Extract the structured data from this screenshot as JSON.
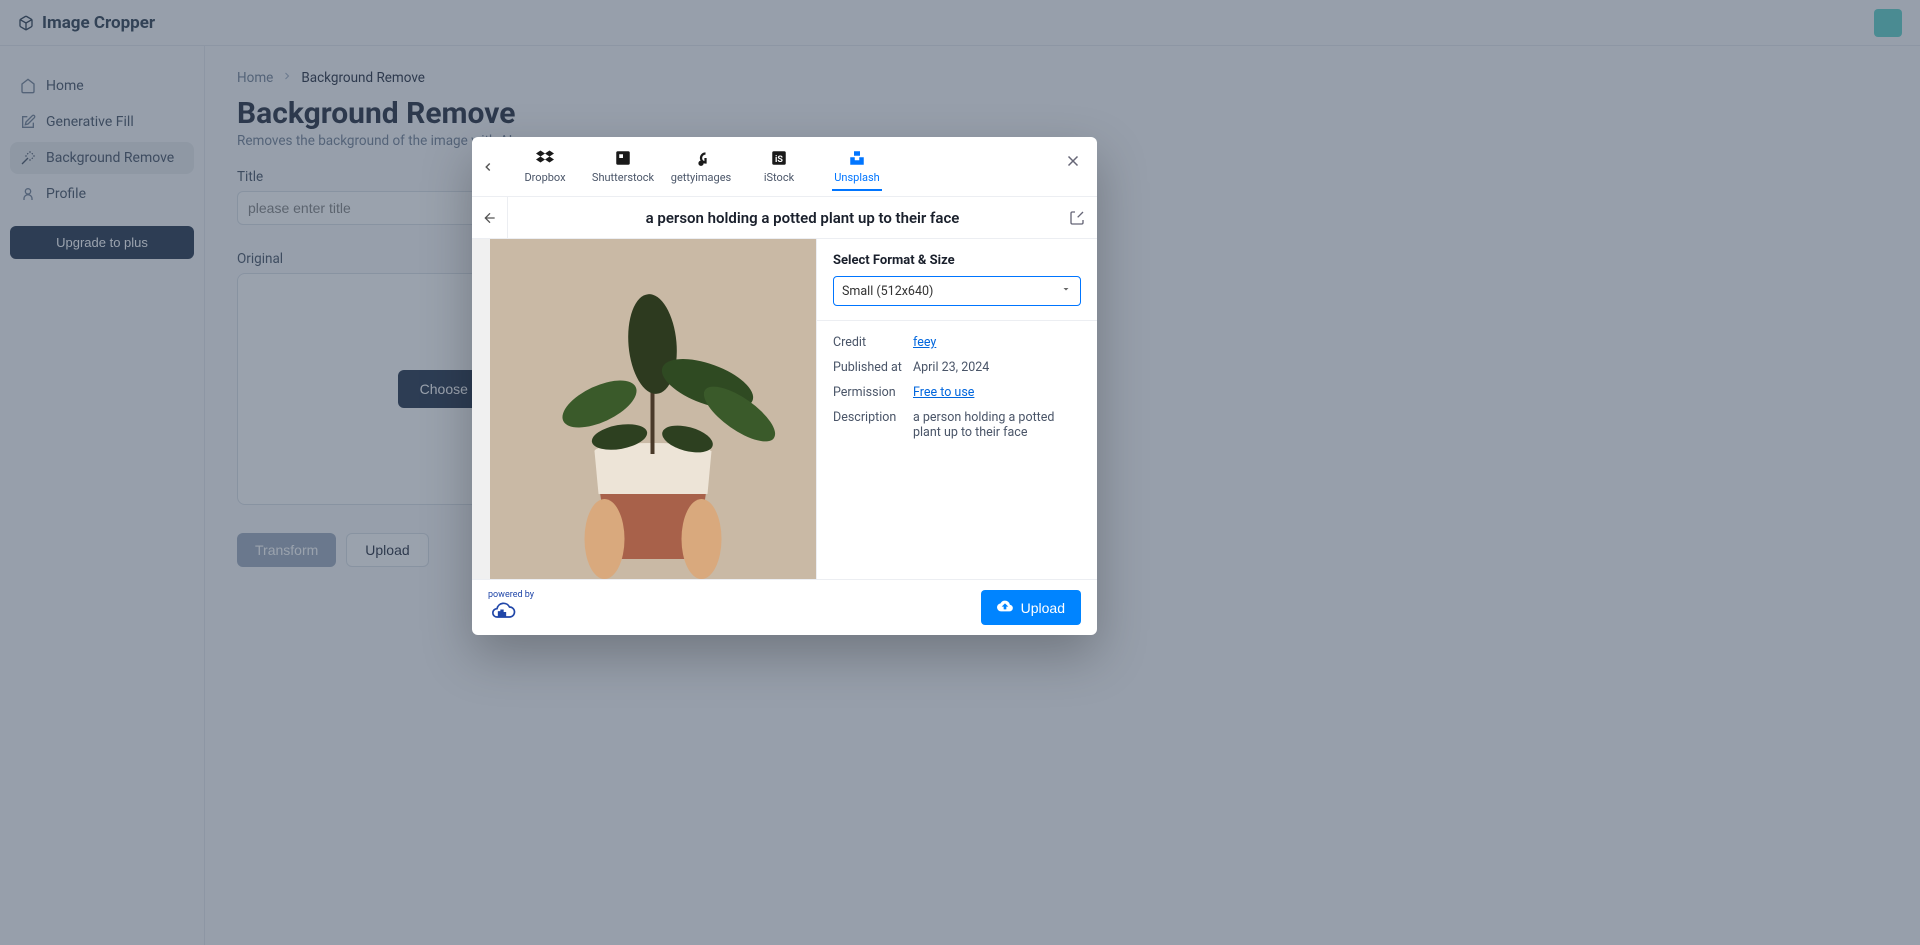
{
  "header": {
    "app_name": "Image Cropper"
  },
  "sidebar": {
    "items": [
      {
        "label": "Home",
        "icon": "home-icon"
      },
      {
        "label": "Generative Fill",
        "icon": "edit-icon"
      },
      {
        "label": "Background Remove",
        "icon": "wand-icon"
      },
      {
        "label": "Profile",
        "icon": "user-icon"
      }
    ],
    "upgrade_label": "Upgrade to plus"
  },
  "breadcrumb": {
    "root": "Home",
    "current": "Background Remove"
  },
  "page": {
    "title": "Background Remove",
    "subtitle": "Removes the background of the image with AI",
    "title_field_label": "Title",
    "title_placeholder": "please enter title",
    "original_label": "Original",
    "choose_file_label": "Choose File",
    "transform_label": "Transform",
    "upload_label": "Upload"
  },
  "modal": {
    "sources": [
      {
        "label": "Dropbox"
      },
      {
        "label": "Shutterstock"
      },
      {
        "label": "gettyimages"
      },
      {
        "label": "iStock"
      },
      {
        "label": "Unsplash"
      }
    ],
    "active_source_index": 4,
    "image_title": "a person holding a potted plant up to their face",
    "format_label": "Select Format & Size",
    "format_selected": "Small (512x640)",
    "meta": {
      "credit_key": "Credit",
      "credit_val": "feey",
      "published_key": "Published at",
      "published_val": "April 23, 2024",
      "permission_key": "Permission",
      "permission_val": "Free to use",
      "description_key": "Description",
      "description_val": "a person holding a potted plant up to their face"
    },
    "powered_by": "powered by",
    "upload_label": "Upload"
  }
}
